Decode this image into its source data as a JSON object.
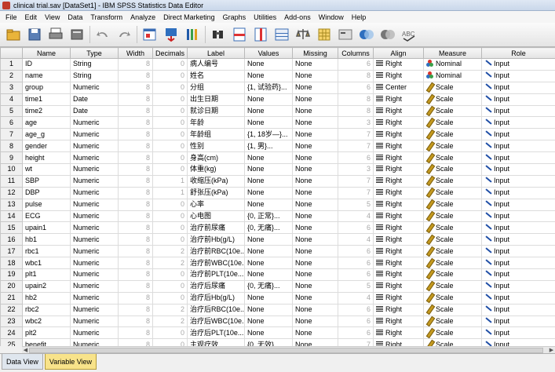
{
  "window": {
    "title": "clinical trial.sav [DataSet1] - IBM SPSS Statistics Data Editor"
  },
  "menu": [
    "File",
    "Edit",
    "View",
    "Data",
    "Transform",
    "Analyze",
    "Direct Marketing",
    "Graphs",
    "Utilities",
    "Add-ons",
    "Window",
    "Help"
  ],
  "toolbar_icons": [
    "open-folder-icon",
    "save-icon",
    "print-icon",
    "dialog-recall-icon",
    "undo-icon",
    "redo-icon",
    "goto-case-icon",
    "goto-variable-icon",
    "variables-icon",
    "find-icon",
    "insert-cases-icon",
    "insert-variable-icon",
    "split-file-icon",
    "weight-cases-icon",
    "select-cases-icon",
    "value-labels-icon",
    "use-sets-icon",
    "show-all-variables-icon",
    "spelling-icon"
  ],
  "columns": [
    "Name",
    "Type",
    "Width",
    "Decimals",
    "Label",
    "Values",
    "Missing",
    "Columns",
    "Align",
    "Measure",
    "Role"
  ],
  "rows": [
    [
      "1",
      "ID",
      "String",
      "8",
      "0",
      "病人编号",
      "None",
      "None",
      "6",
      "Right",
      "Nominal",
      "Input"
    ],
    [
      "2",
      "name",
      "String",
      "8",
      "0",
      "姓名",
      "None",
      "None",
      "8",
      "Right",
      "Nominal",
      "Input"
    ],
    [
      "3",
      "group",
      "Numeric",
      "8",
      "0",
      "分组",
      "{1, 试验药}...",
      "None",
      "6",
      "Center",
      "Scale",
      "Input"
    ],
    [
      "4",
      "time1",
      "Date",
      "8",
      "0",
      "出生日期",
      "None",
      "None",
      "8",
      "Right",
      "Scale",
      "Input"
    ],
    [
      "5",
      "time2",
      "Date",
      "8",
      "0",
      "就诊日期",
      "None",
      "None",
      "8",
      "Right",
      "Scale",
      "Input"
    ],
    [
      "6",
      "age",
      "Numeric",
      "8",
      "0",
      "年龄",
      "None",
      "None",
      "3",
      "Right",
      "Scale",
      "Input"
    ],
    [
      "7",
      "age_g",
      "Numeric",
      "8",
      "0",
      "年龄组",
      "{1, 18岁—}...",
      "None",
      "7",
      "Right",
      "Scale",
      "Input"
    ],
    [
      "8",
      "gender",
      "Numeric",
      "8",
      "0",
      "性别",
      "{1, 男}...",
      "None",
      "7",
      "Right",
      "Scale",
      "Input"
    ],
    [
      "9",
      "height",
      "Numeric",
      "8",
      "0",
      "身高(cm)",
      "None",
      "None",
      "6",
      "Right",
      "Scale",
      "Input"
    ],
    [
      "10",
      "wt",
      "Numeric",
      "8",
      "0",
      "体重(kg)",
      "None",
      "None",
      "3",
      "Right",
      "Scale",
      "Input"
    ],
    [
      "11",
      "SBP",
      "Numeric",
      "8",
      "1",
      "收缩压(kPa)",
      "None",
      "None",
      "7",
      "Right",
      "Scale",
      "Input"
    ],
    [
      "12",
      "DBP",
      "Numeric",
      "8",
      "1",
      "舒张压(kPa)",
      "None",
      "None",
      "7",
      "Right",
      "Scale",
      "Input"
    ],
    [
      "13",
      "pulse",
      "Numeric",
      "8",
      "0",
      "心率",
      "None",
      "None",
      "5",
      "Right",
      "Scale",
      "Input"
    ],
    [
      "14",
      "ECG",
      "Numeric",
      "8",
      "0",
      "心电图",
      "{0, 正常}...",
      "None",
      "4",
      "Right",
      "Scale",
      "Input"
    ],
    [
      "15",
      "upain1",
      "Numeric",
      "8",
      "0",
      "治疗前尿痛",
      "{0, 无痛}...",
      "None",
      "6",
      "Right",
      "Scale",
      "Input"
    ],
    [
      "16",
      "hb1",
      "Numeric",
      "8",
      "0",
      "治疗前Hb(g/L)",
      "None",
      "None",
      "4",
      "Right",
      "Scale",
      "Input"
    ],
    [
      "17",
      "rbc1",
      "Numeric",
      "8",
      "2",
      "治疗前RBC(10e...",
      "None",
      "None",
      "6",
      "Right",
      "Scale",
      "Input"
    ],
    [
      "18",
      "wbc1",
      "Numeric",
      "8",
      "2",
      "治疗前WBC(10e...",
      "None",
      "None",
      "6",
      "Right",
      "Scale",
      "Input"
    ],
    [
      "19",
      "plt1",
      "Numeric",
      "8",
      "0",
      "治疗前PLT(10e...",
      "None",
      "None",
      "6",
      "Right",
      "Scale",
      "Input"
    ],
    [
      "20",
      "upain2",
      "Numeric",
      "8",
      "0",
      "治疗后尿痛",
      "{0, 无痛}...",
      "None",
      "5",
      "Right",
      "Scale",
      "Input"
    ],
    [
      "21",
      "hb2",
      "Numeric",
      "8",
      "0",
      "治疗后Hb(g/L)",
      "None",
      "None",
      "4",
      "Right",
      "Scale",
      "Input"
    ],
    [
      "22",
      "rbc2",
      "Numeric",
      "8",
      "2",
      "治疗后RBC(10e...",
      "None",
      "None",
      "6",
      "Right",
      "Scale",
      "Input"
    ],
    [
      "23",
      "wbc2",
      "Numeric",
      "8",
      "2",
      "治疗后WBC(10e...",
      "None",
      "None",
      "6",
      "Right",
      "Scale",
      "Input"
    ],
    [
      "24",
      "plt2",
      "Numeric",
      "8",
      "0",
      "治疗后PLT(10e...",
      "None",
      "None",
      "6",
      "Right",
      "Scale",
      "Input"
    ],
    [
      "25",
      "benefit",
      "Numeric",
      "8",
      "0",
      "主观疗效",
      "{0, 无效}...",
      "None",
      "7",
      "Right",
      "Scale",
      "Input"
    ]
  ],
  "tabs": [
    "Data View",
    "Variable View"
  ],
  "active_tab": "Variable View"
}
